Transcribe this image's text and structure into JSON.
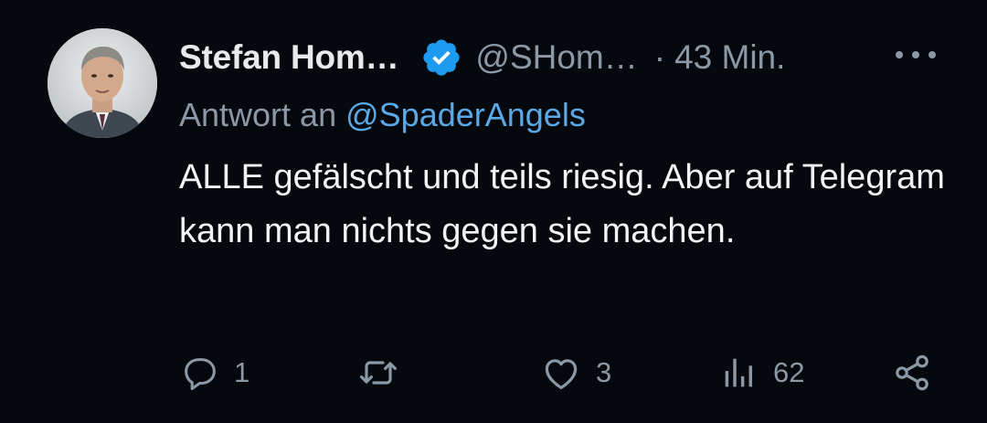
{
  "author": {
    "name": "Stefan Hom…",
    "handle": "@SHom…",
    "separator": "·",
    "time": "43 Min.",
    "verified": true
  },
  "reply": {
    "prefix": "Antwort an",
    "mention": "@SpaderAngels"
  },
  "tweet": {
    "text": "ALLE gefälscht und teils riesig. Aber auf Telegram kann man nichts gegen sie machen."
  },
  "actions": {
    "reply_count": "1",
    "retweet_count": "",
    "like_count": "3",
    "view_count": "62"
  },
  "colors": {
    "background": "#05080d",
    "primary_text": "#e7e9ea",
    "secondary_text": "#8b98a5",
    "link": "#5aa9e6",
    "verified_badge": "#1d9bf0"
  },
  "icons": {
    "verified": "verified-badge-icon",
    "more": "more-dots-icon",
    "reply": "reply-bubble-icon",
    "retweet": "retweet-icon",
    "like": "heart-icon",
    "views": "views-bar-icon",
    "share": "share-icon"
  }
}
